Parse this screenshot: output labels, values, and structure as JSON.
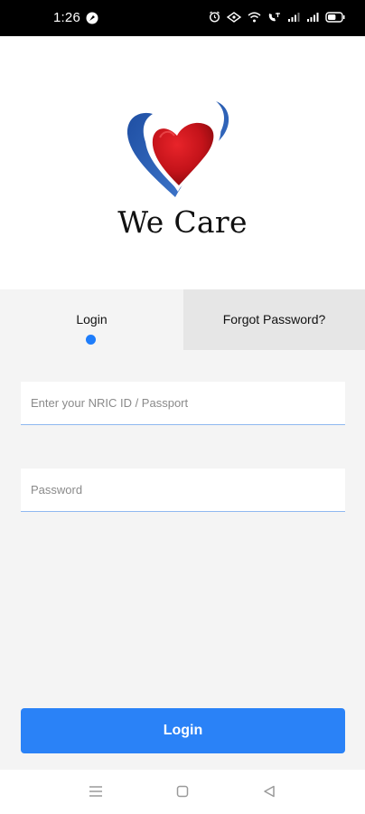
{
  "status_bar": {
    "time": "1:26",
    "battery_level": 0.6
  },
  "app": {
    "name": "We Care"
  },
  "tabs": [
    {
      "label": "Login",
      "active": true
    },
    {
      "label": "Forgot Password?",
      "active": false
    }
  ],
  "form": {
    "id_placeholder": "Enter your NRIC ID / Passport",
    "password_placeholder": "Password",
    "login_button": "Login"
  },
  "colors": {
    "accent": "#2a82f7",
    "heart_red": "#c4131a",
    "heart_blue": "#2a5aab"
  },
  "nav_bar": {
    "icons": [
      "menu-icon",
      "home-square-icon",
      "back-triangle-icon"
    ]
  }
}
